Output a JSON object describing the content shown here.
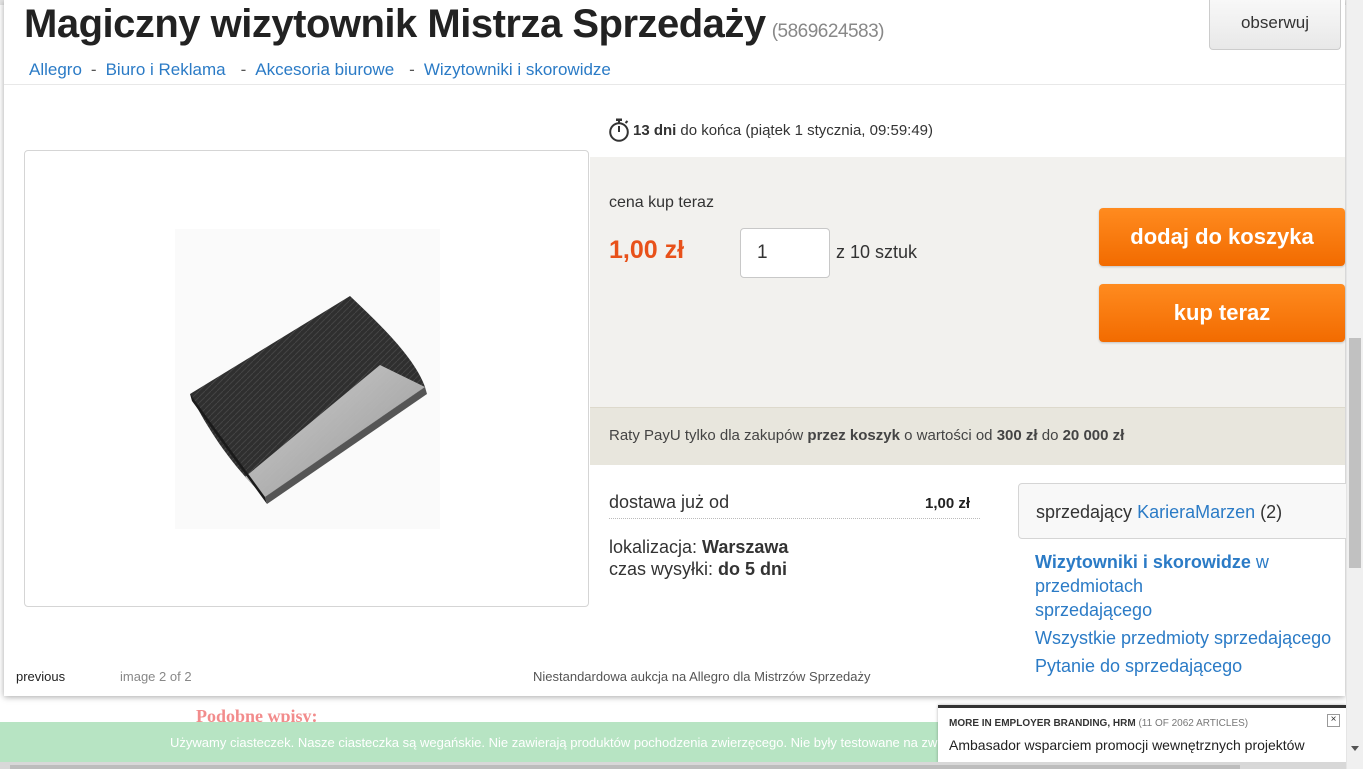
{
  "header": {
    "title": "Magiczny wizytownik Mistrza Sprzedaży",
    "item_id": "(5869624583)",
    "follow_label": "obserwuj"
  },
  "breadcrumb": [
    "Allegro",
    "Biuro i Reklama",
    "Akcesoria biurowe",
    "Wizytowniki i skorowidze"
  ],
  "breadcrumb_sep": "-",
  "timer": {
    "icon": "stopwatch-icon",
    "days": "13 dni",
    "rest": "do końca (piątek 1 stycznia, 09:59:49)"
  },
  "buy": {
    "price_label": "cena kup teraz",
    "price": "1,00 zł",
    "quantity": "1",
    "quantity_of": "z 10 sztuk",
    "add_to_cart": "dodaj do koszyka",
    "buy_now": "kup teraz",
    "accent_color": "#f26b00",
    "price_color": "#e8511a"
  },
  "payu": {
    "t1": "Raty PayU tylko dla zakupów ",
    "t2": "przez koszyk",
    "t3": " o wartości od ",
    "t4": "300 zł",
    "t5": " do ",
    "t6": "20 000 zł"
  },
  "delivery": {
    "label": "dostawa już od",
    "price": "1,00 zł",
    "location_label": "lokalizacja: ",
    "location": "Warszawa",
    "shipping_label": "czas wysyłki: ",
    "shipping": "do 5 dni"
  },
  "seller": {
    "label": "sprzedający ",
    "name": "KarieraMarzen",
    "count": " (2)",
    "link1_bold": "Wizytowniki i skorowidze",
    "link1_rest": " w przedmiotach",
    "link1_line2": "sprzedającego",
    "link2": "Wszystkie przedmioty sprzedającego",
    "link3": "Pytanie do sprzedającego"
  },
  "gallery": {
    "previous": "previous",
    "counter": "image 2 of 2",
    "note": "Niestandardowa aukcja na Allegro dla Mistrzów Sprzedaży"
  },
  "background": {
    "similar_heading": "Podobne wpisy:"
  },
  "cookie": {
    "text": "Używamy ciasteczek. Nasze ciasteczka są wegańskie. Nie zawierają produktów pochodzenia zwierzęcego. Nie były testowane na zwierzętach."
  },
  "article_popup": {
    "head": "MORE IN EMPLOYER BRANDING, HRM",
    "count": "(11 OF 2062 ARTICLES)",
    "title": "Ambasador wsparciem promocji wewnętrznych projektów",
    "close": "×"
  }
}
